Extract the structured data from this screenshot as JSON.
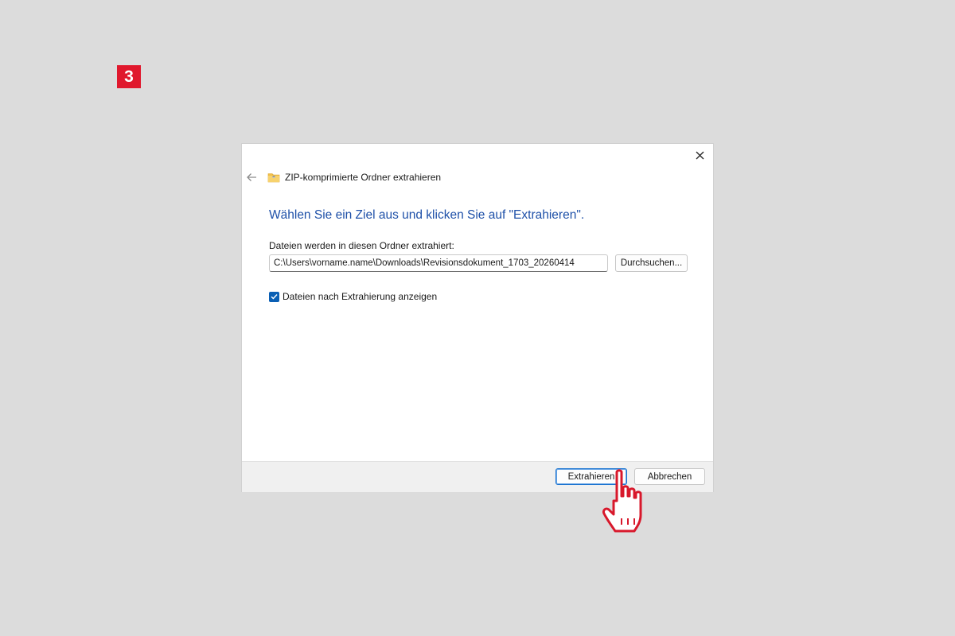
{
  "step_badge": "3",
  "dialog": {
    "title": "ZIP-komprimierte Ordner extrahieren",
    "instruction": "Wählen Sie ein Ziel aus und klicken Sie auf \"Extrahieren\".",
    "field_label": "Dateien werden in diesen Ordner extrahiert:",
    "path_value": "C:\\Users\\vorname.name\\Downloads\\Revisionsdokument_1703_20260414",
    "browse_label": "Durchsuchen...",
    "checkbox_label": "Dateien nach Extrahierung anzeigen",
    "checkbox_checked": true,
    "extract_label": "Extrahieren",
    "cancel_label": "Abbrechen"
  },
  "colors": {
    "accent": "#1e50a8",
    "badge": "#e0182d",
    "checkbox": "#0a5fb4"
  },
  "icons": {
    "close": "close-icon",
    "back": "back-arrow-icon",
    "folder": "zip-folder-icon",
    "cursor": "hand-pointer-icon"
  }
}
